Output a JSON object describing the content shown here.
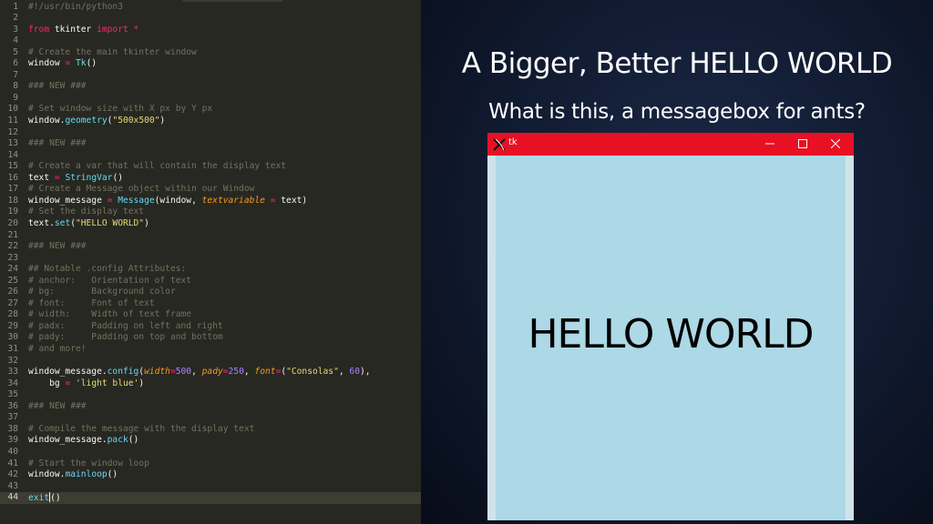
{
  "editor": {
    "lines": [
      {
        "n": "1",
        "tokens": [
          [
            "c",
            "#!/usr/bin/python3"
          ]
        ]
      },
      {
        "n": "2",
        "tokens": []
      },
      {
        "n": "3",
        "tokens": [
          [
            "k",
            "from"
          ],
          [
            "x",
            " tkinter "
          ],
          [
            "k",
            "import"
          ],
          [
            "x",
            " "
          ],
          [
            "k",
            "*"
          ]
        ]
      },
      {
        "n": "4",
        "tokens": []
      },
      {
        "n": "5",
        "tokens": [
          [
            "c",
            "# Create the main tkinter window"
          ]
        ]
      },
      {
        "n": "6",
        "tokens": [
          [
            "x",
            "window "
          ],
          [
            "k",
            "="
          ],
          [
            "x",
            " "
          ],
          [
            "f",
            "Tk"
          ],
          [
            "x",
            "()"
          ]
        ]
      },
      {
        "n": "7",
        "tokens": []
      },
      {
        "n": "8",
        "tokens": [
          [
            "c",
            "### NEW ###"
          ]
        ]
      },
      {
        "n": "9",
        "tokens": []
      },
      {
        "n": "10",
        "tokens": [
          [
            "c",
            "# Set window size with X px by Y px"
          ]
        ]
      },
      {
        "n": "11",
        "tokens": [
          [
            "x",
            "window."
          ],
          [
            "f",
            "geometry"
          ],
          [
            "x",
            "("
          ],
          [
            "s",
            "\"500x500\""
          ],
          [
            "x",
            ")"
          ]
        ]
      },
      {
        "n": "12",
        "tokens": []
      },
      {
        "n": "13",
        "tokens": [
          [
            "c",
            "### NEW ###"
          ]
        ]
      },
      {
        "n": "14",
        "tokens": []
      },
      {
        "n": "15",
        "tokens": [
          [
            "c",
            "# Create a var that will contain the display text"
          ]
        ]
      },
      {
        "n": "16",
        "tokens": [
          [
            "x",
            "text "
          ],
          [
            "k",
            "="
          ],
          [
            "x",
            " "
          ],
          [
            "f",
            "StringVar"
          ],
          [
            "x",
            "()"
          ]
        ]
      },
      {
        "n": "17",
        "tokens": [
          [
            "c",
            "# Create a Message object within our Window"
          ]
        ]
      },
      {
        "n": "18",
        "tokens": [
          [
            "x",
            "window_message "
          ],
          [
            "k",
            "="
          ],
          [
            "x",
            " "
          ],
          [
            "f",
            "Message"
          ],
          [
            "x",
            "(window, "
          ],
          [
            "p",
            "textvariable"
          ],
          [
            "x",
            " "
          ],
          [
            "k",
            "="
          ],
          [
            "x",
            " text)"
          ]
        ]
      },
      {
        "n": "19",
        "tokens": [
          [
            "c",
            "# Set the display text"
          ]
        ]
      },
      {
        "n": "20",
        "tokens": [
          [
            "x",
            "text."
          ],
          [
            "f",
            "set"
          ],
          [
            "x",
            "("
          ],
          [
            "s",
            "\"HELLO WORLD\""
          ],
          [
            "x",
            ")"
          ]
        ]
      },
      {
        "n": "21",
        "tokens": []
      },
      {
        "n": "22",
        "tokens": [
          [
            "c",
            "### NEW ###"
          ]
        ]
      },
      {
        "n": "23",
        "tokens": []
      },
      {
        "n": "24",
        "tokens": [
          [
            "c",
            "## Notable .config Attributes:"
          ]
        ]
      },
      {
        "n": "25",
        "tokens": [
          [
            "c",
            "# anchor:   Orientation of text"
          ]
        ]
      },
      {
        "n": "26",
        "tokens": [
          [
            "c",
            "# bg:       Background color"
          ]
        ]
      },
      {
        "n": "27",
        "tokens": [
          [
            "c",
            "# font:     Font of text"
          ]
        ]
      },
      {
        "n": "28",
        "tokens": [
          [
            "c",
            "# width:    Width of text frame"
          ]
        ]
      },
      {
        "n": "29",
        "tokens": [
          [
            "c",
            "# padx:     Padding on left and right"
          ]
        ]
      },
      {
        "n": "30",
        "tokens": [
          [
            "c",
            "# pady:     Padding on top and bottom"
          ]
        ]
      },
      {
        "n": "31",
        "tokens": [
          [
            "c",
            "# and more!"
          ]
        ]
      },
      {
        "n": "32",
        "tokens": []
      },
      {
        "n": "33",
        "tokens": [
          [
            "x",
            "window_message."
          ],
          [
            "f",
            "config"
          ],
          [
            "x",
            "("
          ],
          [
            "p",
            "width"
          ],
          [
            "k",
            "="
          ],
          [
            "n",
            "500"
          ],
          [
            "x",
            ", "
          ],
          [
            "p",
            "pady"
          ],
          [
            "k",
            "="
          ],
          [
            "n",
            "250"
          ],
          [
            "x",
            ", "
          ],
          [
            "p",
            "font"
          ],
          [
            "k",
            "="
          ],
          [
            "x",
            "("
          ],
          [
            "s",
            "\"Consolas\""
          ],
          [
            "x",
            ", "
          ],
          [
            "n",
            "60"
          ],
          [
            "x",
            "),"
          ]
        ]
      },
      {
        "n": "34",
        "tokens": [
          [
            "x",
            "    bg "
          ],
          [
            "k",
            "="
          ],
          [
            "x",
            " "
          ],
          [
            "s",
            "'light blue'"
          ],
          [
            "x",
            ")"
          ]
        ]
      },
      {
        "n": "35",
        "tokens": []
      },
      {
        "n": "36",
        "tokens": [
          [
            "c",
            "### NEW ###"
          ]
        ]
      },
      {
        "n": "37",
        "tokens": []
      },
      {
        "n": "38",
        "tokens": [
          [
            "c",
            "# Compile the message with the display text"
          ]
        ]
      },
      {
        "n": "39",
        "tokens": [
          [
            "x",
            "window_message."
          ],
          [
            "f",
            "pack"
          ],
          [
            "x",
            "()"
          ]
        ]
      },
      {
        "n": "40",
        "tokens": []
      },
      {
        "n": "41",
        "tokens": [
          [
            "c",
            "# Start the window loop"
          ]
        ]
      },
      {
        "n": "42",
        "tokens": [
          [
            "x",
            "window."
          ],
          [
            "f",
            "mainloop"
          ],
          [
            "x",
            "()"
          ]
        ]
      },
      {
        "n": "43",
        "tokens": []
      },
      {
        "n": "44",
        "tokens": [
          [
            "f",
            "exit"
          ],
          [
            "x",
            "()"
          ]
        ],
        "current": true
      }
    ]
  },
  "slide": {
    "title": "A Bigger, Better HELLO WORLD",
    "subtitle": "What is this, a messagebox for ants?"
  },
  "tk_window": {
    "title": "tk",
    "message": "HELLO WORLD",
    "titlebar_color": "#e81123",
    "background_color": "#add8e6",
    "icons": {
      "logo": "tk-feather-icon",
      "minimize": "minimize-icon",
      "maximize": "maximize-icon",
      "close": "close-icon"
    }
  }
}
